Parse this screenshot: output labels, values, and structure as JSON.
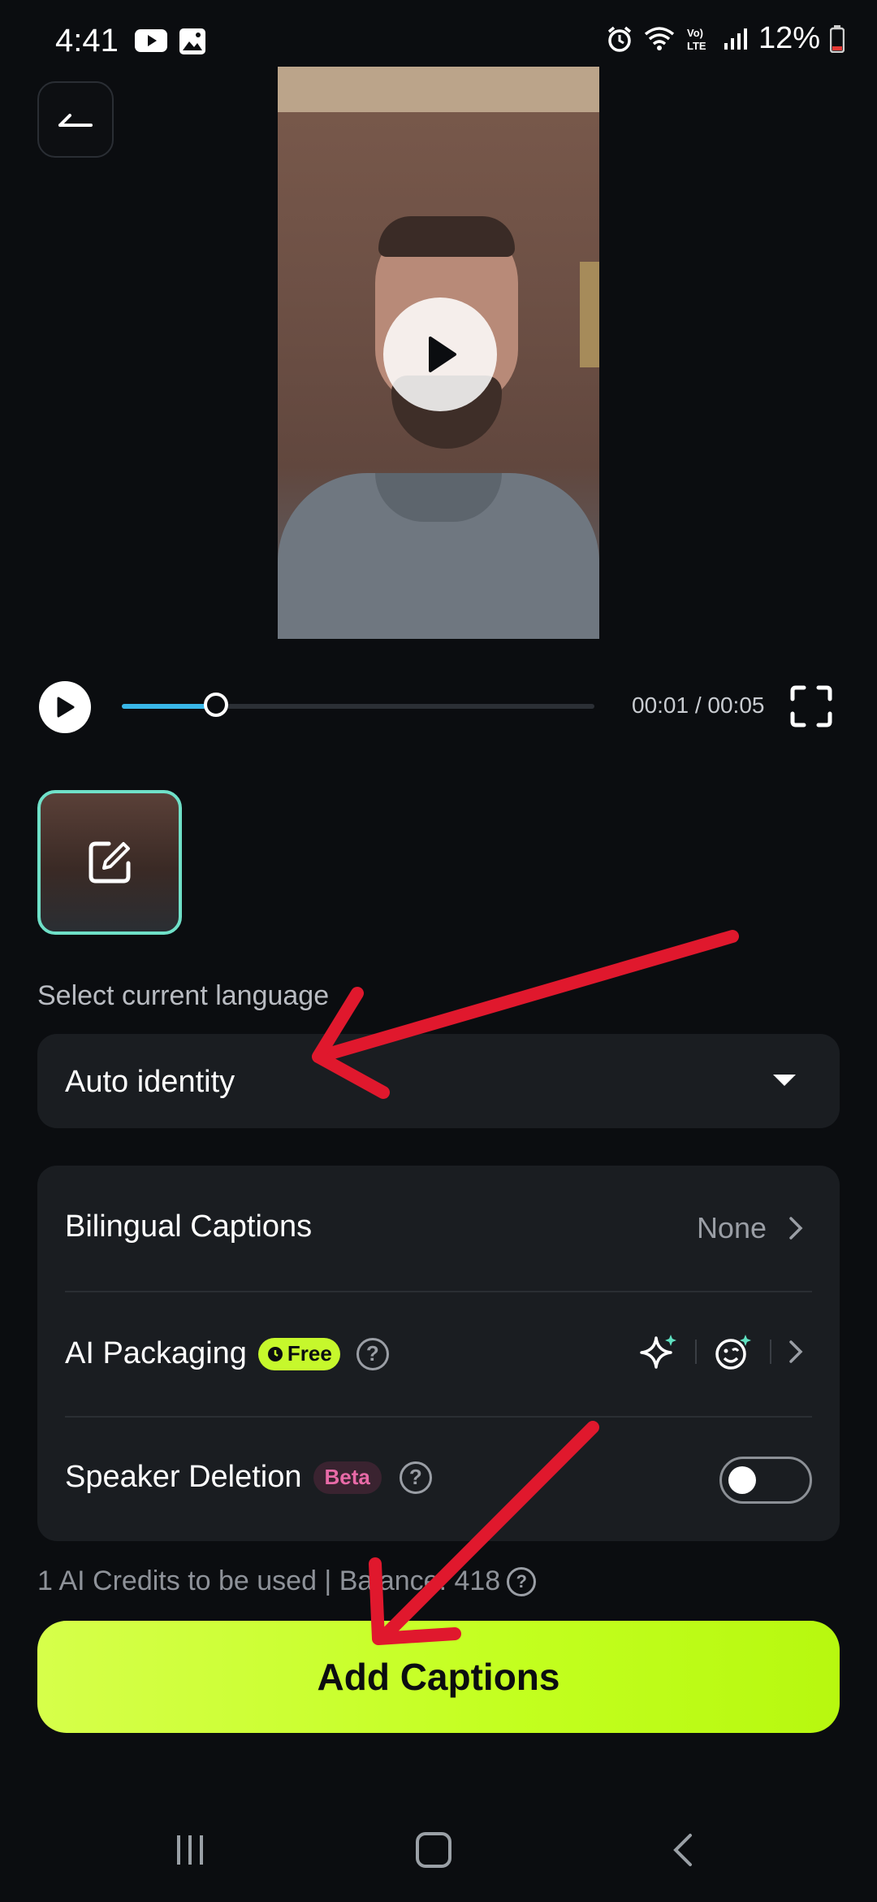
{
  "status_bar": {
    "time": "4:41",
    "battery": "12%",
    "icons": [
      "youtube-icon",
      "gallery-icon",
      "alarm-icon",
      "wifi-icon",
      "volte-icon",
      "signal-icon",
      "battery-icon"
    ]
  },
  "player": {
    "time_readout": "00:01 / 00:05",
    "progress_fraction": 0.2
  },
  "language": {
    "label": "Select current language",
    "value": "Auto identity"
  },
  "options": {
    "bilingual": {
      "label": "Bilingual Captions",
      "value": "None"
    },
    "ai_packaging": {
      "label": "AI Packaging",
      "badge": "Free"
    },
    "speaker_deletion": {
      "label": "Speaker Deletion",
      "badge": "Beta",
      "enabled": false
    }
  },
  "credits": {
    "text": "1 AI Credits to be used | Balance: 418"
  },
  "primary_button": {
    "label": "Add Captions"
  },
  "colors": {
    "accent": "#c3ff1f",
    "progress": "#39b7e8",
    "thumb_border": "#6fe0c8",
    "annotation_arrow": "#e0182d"
  }
}
